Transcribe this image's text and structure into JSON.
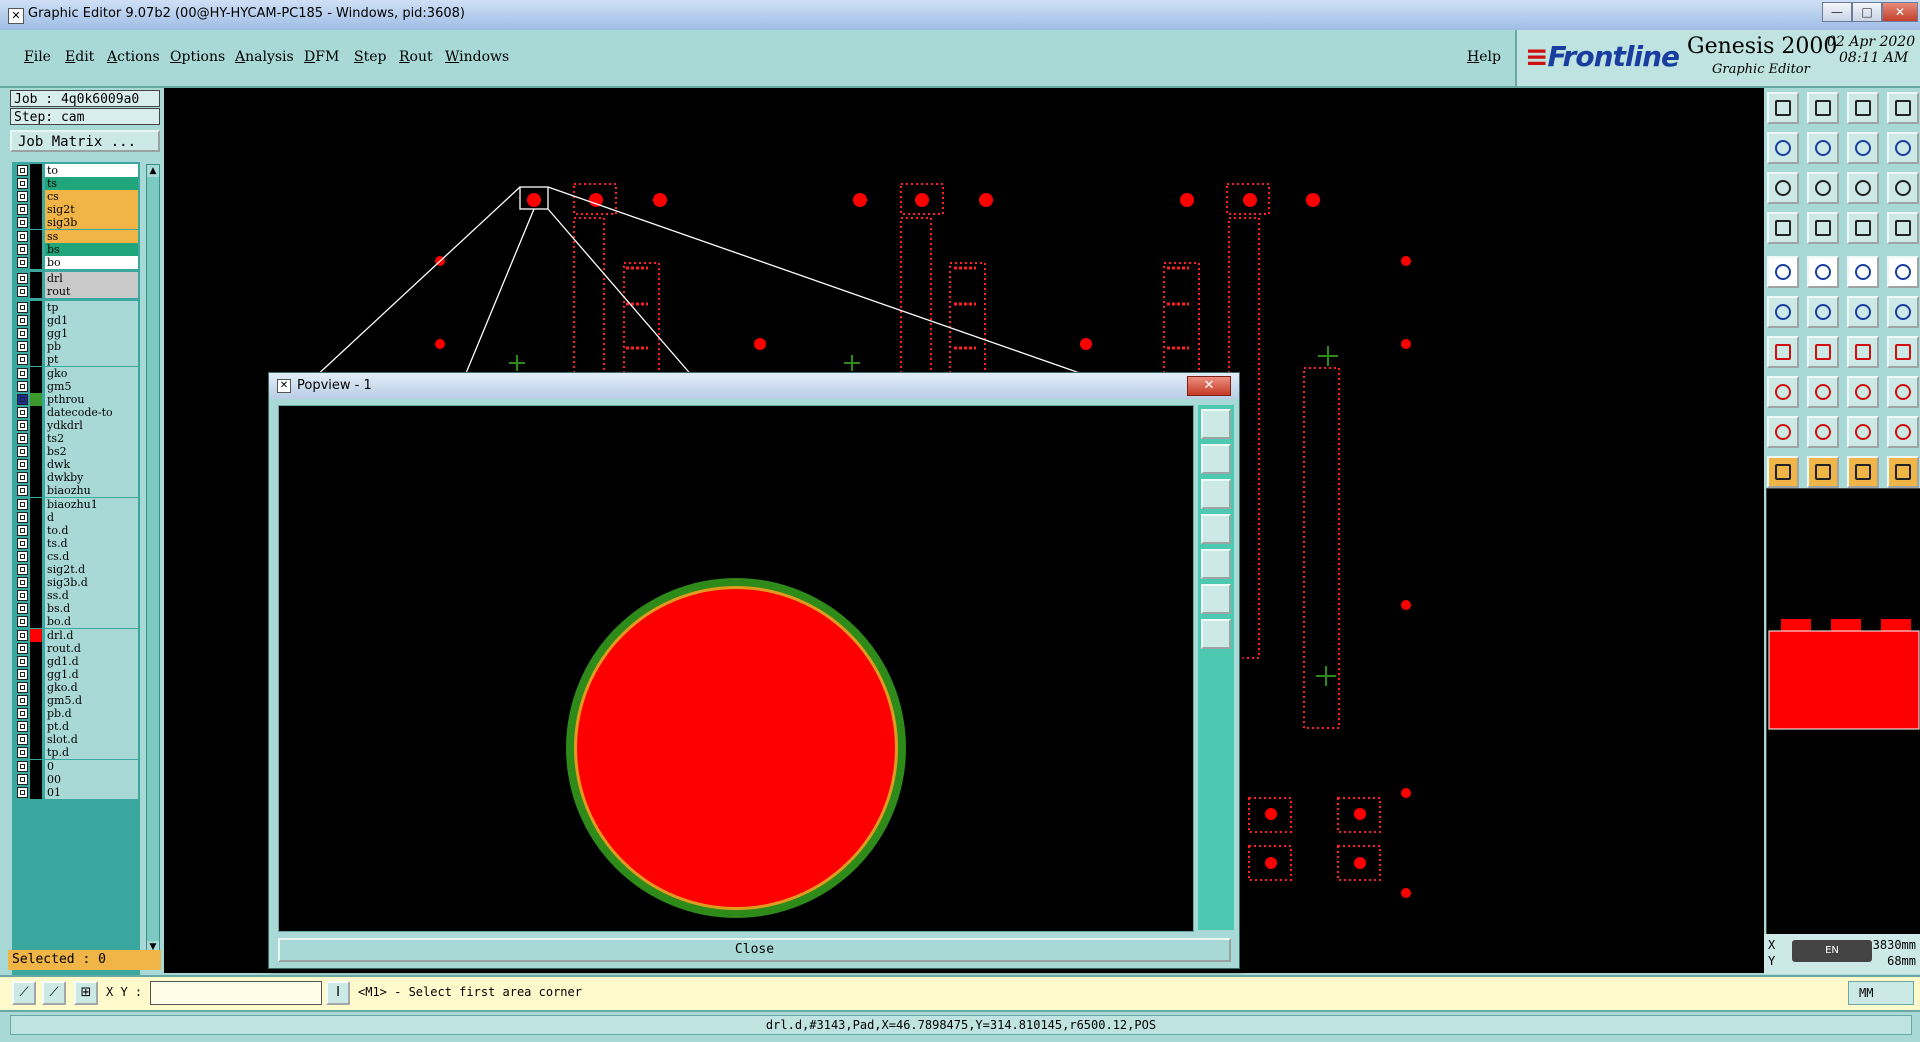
{
  "window": {
    "title": "Graphic Editor 9.07b2 (00@HY-HYCAM-PC185 - Windows, pid:3608)",
    "min": "—",
    "max": "□",
    "close": "✕"
  },
  "menu": [
    "File",
    "Edit",
    "Actions",
    "Options",
    "Analysis",
    "DFM",
    "Step",
    "Rout",
    "Windows"
  ],
  "help": "Help",
  "brand": {
    "logo": "Frontline",
    "product": "Genesis 2000",
    "subtitle": "Graphic Editor",
    "date": "02 Apr 2020",
    "time": "08:11 AM"
  },
  "job": {
    "job_label": "Job : 4q0k6009a0",
    "step_label": "Step: cam",
    "matrix_button": "Job Matrix ..."
  },
  "layers": [
    {
      "name": "to",
      "bg": "#ffffff",
      "aff": true
    },
    {
      "name": "ts",
      "bg": "#20a67a"
    },
    {
      "name": "cs",
      "bg": "#f1b447"
    },
    {
      "name": "sig2t",
      "bg": "#f1b447"
    },
    {
      "name": "sig3b",
      "bg": "#f1b447"
    },
    {
      "name": "ss",
      "bg": "#f1b447"
    },
    {
      "name": "bs",
      "bg": "#20a67a"
    },
    {
      "name": "bo",
      "bg": "#ffffff",
      "aff": true
    },
    {
      "name": "drl",
      "bg": "#c9c9c9",
      "gap": true
    },
    {
      "name": "rout",
      "bg": "#c9c9c9"
    },
    {
      "name": "tp",
      "gap": true
    },
    {
      "name": "gd1",
      "aff": true
    },
    {
      "name": "gg1"
    },
    {
      "name": "pb"
    },
    {
      "name": "pt"
    },
    {
      "name": "gko",
      "aff": true
    },
    {
      "name": "gm5"
    },
    {
      "name": "pthrou",
      "clr": "#3c9a2c",
      "aff": true,
      "blue": true
    },
    {
      "name": "datecode-to"
    },
    {
      "name": "ydkdrl"
    },
    {
      "name": "ts2"
    },
    {
      "name": "bs2"
    },
    {
      "name": "dwk"
    },
    {
      "name": "dwkby"
    },
    {
      "name": "biaozhu"
    },
    {
      "name": "biaozhu1"
    },
    {
      "name": "d"
    },
    {
      "name": "to.d",
      "aff": true
    },
    {
      "name": "ts.d"
    },
    {
      "name": "cs.d"
    },
    {
      "name": "sig2t.d"
    },
    {
      "name": "sig3b.d"
    },
    {
      "name": "ss.d"
    },
    {
      "name": "bs.d"
    },
    {
      "name": "bo.d",
      "aff": true
    },
    {
      "name": "drl.d",
      "clr": "#ff0000"
    },
    {
      "name": "rout.d"
    },
    {
      "name": "gd1.d",
      "aff": true
    },
    {
      "name": "gg1.d"
    },
    {
      "name": "gko.d",
      "aff": true
    },
    {
      "name": "gm5.d"
    },
    {
      "name": "pb.d"
    },
    {
      "name": "pt.d"
    },
    {
      "name": "slot.d"
    },
    {
      "name": "tp.d"
    },
    {
      "name": "0"
    },
    {
      "name": "00"
    },
    {
      "name": "01"
    }
  ],
  "selected": "Selected : 0",
  "popup": {
    "title": "Popview - 1",
    "close_label": "Close",
    "x_label": "✕"
  },
  "command": {
    "xy_label": "X Y :",
    "xy_value": "",
    "cursor_btn": "I",
    "prompt": "<M1> - Select first area corner",
    "unit": "MM"
  },
  "status": "drl.d,#3143,Pad,X=46.7898475,Y=314.810145,r6500.12,POS",
  "readout": {
    "x_label": "X",
    "y_label": "Y",
    "x_value": "3830mm",
    "y_value": "68mm",
    "ime": "EN"
  },
  "colors": {
    "pad": "#ff0000",
    "ring": "#2e8b1a",
    "panel": "#a9d9d6",
    "toolbar": "#4cc9b0",
    "highlight": "#f1b447"
  }
}
